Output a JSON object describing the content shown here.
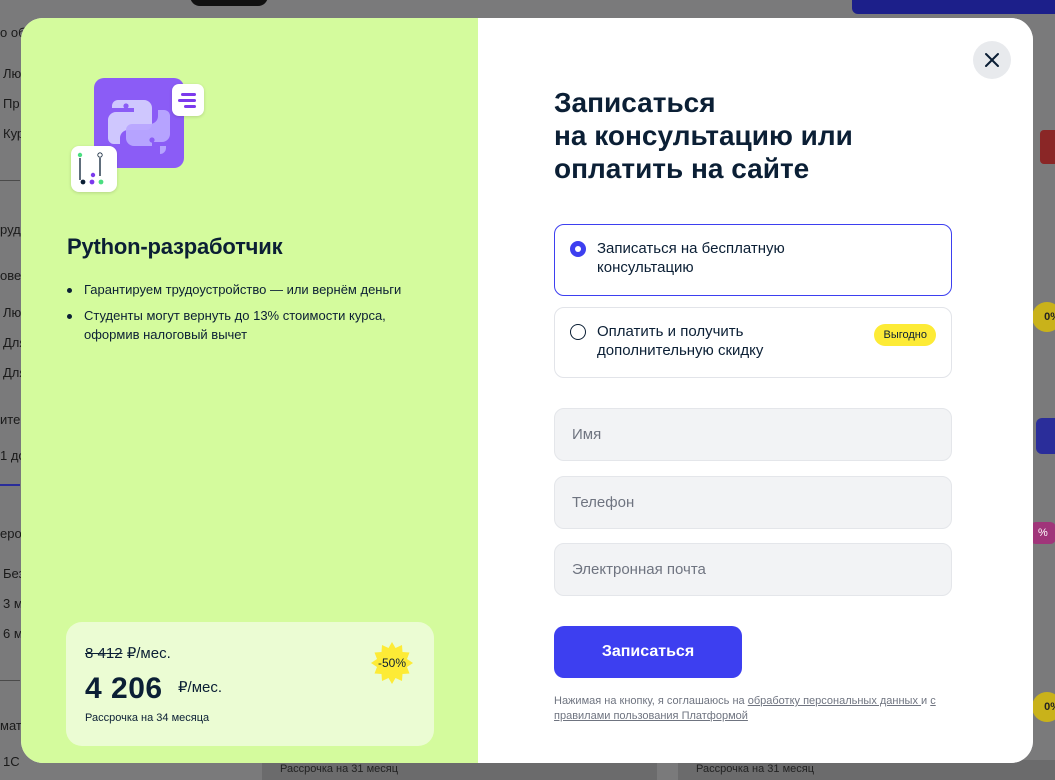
{
  "background": {
    "left_texts": [
      "о об",
      "Лю",
      "Пр",
      "Кур",
      "руд",
      "овен",
      "Лю",
      "Для",
      "Для",
      "ите",
      "1 до",
      "еро",
      "Без",
      "3 м",
      "6 м",
      "мати",
      "1С"
    ],
    "right_badges": [
      "0%",
      "0%"
    ],
    "pink_badge": "%",
    "bottom_strip_1": "Рассрочка на 31 месяц",
    "bottom_strip_2": "Рассрочка на 31 месяц"
  },
  "course": {
    "title": "Python-разработчик",
    "bullets": [
      "Гарантируем трудоустройство — или вернём деньги",
      "Студенты могут вернуть до 13% стоимости курса, оформив налоговый вычет"
    ],
    "logo_icon": "python-logo-icon"
  },
  "pricing": {
    "old_price": "8 412",
    "old_unit": "₽/мес.",
    "new_price": "4 206",
    "new_unit": "₽/мес.",
    "installment": "Рассрочка на 34 месяца",
    "discount_badge": "-50%"
  },
  "form": {
    "title": "Записаться на консультацию или оплатить на сайте",
    "title_lines": [
      "Записаться",
      "на консультацию или",
      "оплатить на сайте"
    ],
    "options": [
      {
        "label": "Записаться на бесплатную консультацию",
        "selected": true
      },
      {
        "label": "Оплатить и получить дополнительную скидку",
        "selected": false,
        "badge": "Выгодно"
      }
    ],
    "name_placeholder": "Имя",
    "phone_placeholder": "Телефон",
    "email_placeholder": "Электронная почта",
    "submit_label": "Записаться",
    "consent_prefix": "Нажимая на кнопку, я соглашаюсь на ",
    "consent_link1": "обработку персональных данных ",
    "consent_middle": "и ",
    "consent_link2": "с правилами пользования Платформой"
  },
  "colors": {
    "accent": "#3d3ff0",
    "left_panel": "#d4fb9d",
    "price_card": "#ebfcd3",
    "badge_yellow": "#fdeb36",
    "logo_purple": "#8b5cf6"
  }
}
